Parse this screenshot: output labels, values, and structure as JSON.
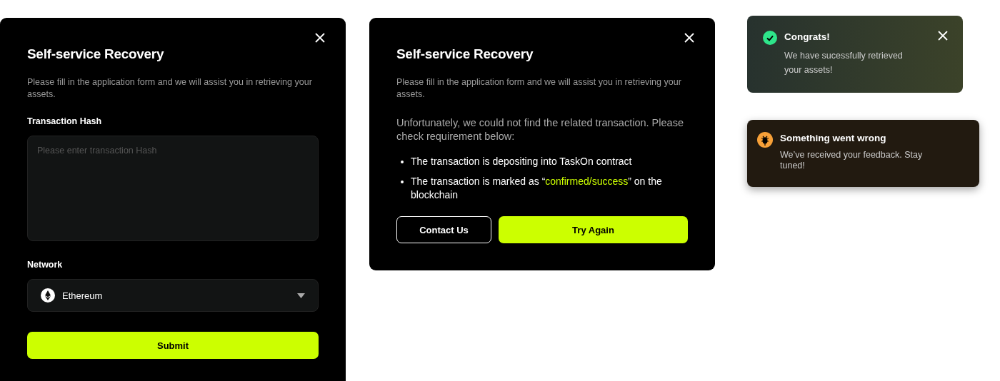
{
  "form_dialog": {
    "title": "Self-service Recovery",
    "description": "Please fill in the application form and we will assist you in retrieving your assets.",
    "hash_field": {
      "label": "Transaction Hash",
      "placeholder": "Please enter transaction Hash"
    },
    "network_field": {
      "label": "Network",
      "value": "Ethereum"
    },
    "submit_button": "Submit"
  },
  "error_dialog": {
    "title": "Self-service Recovery",
    "description": "Please fill in the application form and we will assist you in retrieving your assets.",
    "message": "Unfortunately, we could not find the related transaction. Please check requirement below:",
    "requirements": [
      {
        "before": "The transaction is depositing into TaskOn contract"
      },
      {
        "before": "The transaction is marked as “",
        "highlight": "confirmed/success",
        "after": "” on the blockchain"
      }
    ],
    "buttons": [
      {
        "label": "Contact Us",
        "kind": "outline"
      },
      {
        "label": "Try Again",
        "kind": "primary"
      }
    ]
  },
  "toasts": [
    {
      "kind": "success",
      "title": "Congrats!",
      "message": "We have sucessfully retrieved your assets!",
      "closable": true
    },
    {
      "kind": "error",
      "title": "Something went wrong",
      "message": "We’ve received your feedback. Stay tuned!",
      "closable": false
    }
  ]
}
